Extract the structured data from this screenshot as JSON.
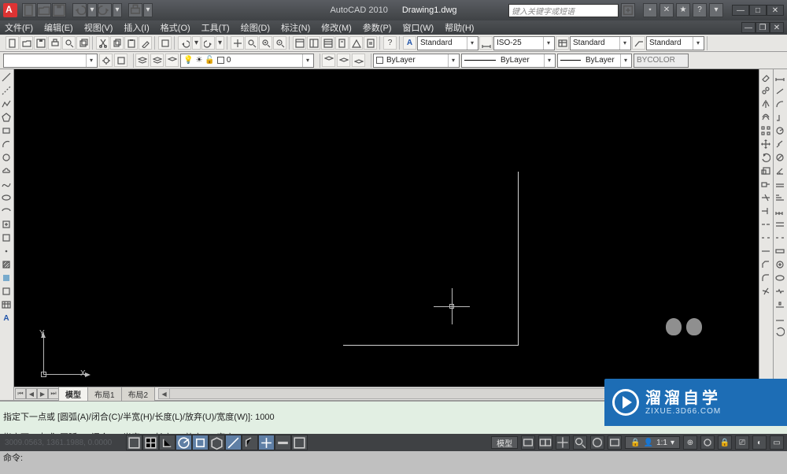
{
  "app": {
    "name": "AutoCAD 2010",
    "document": "Drawing1.dwg"
  },
  "search": {
    "placeholder": "键入关键字或短语"
  },
  "menu": [
    "文件(F)",
    "编辑(E)",
    "视图(V)",
    "插入(I)",
    "格式(O)",
    "工具(T)",
    "绘图(D)",
    "标注(N)",
    "修改(M)",
    "参数(P)",
    "窗口(W)",
    "帮助(H)"
  ],
  "styles": {
    "text": "Standard",
    "dim": "ISO-25",
    "table": "Standard",
    "mleader": "Standard"
  },
  "layers": {
    "current_layer": "0"
  },
  "properties": {
    "color": "ByLayer",
    "linetype": "ByLayer",
    "lineweight": "ByLayer",
    "plotstyle": "BYCOLOR"
  },
  "tabs": {
    "model": "模型",
    "layout1": "布局1",
    "layout2": "布局2"
  },
  "ucs": {
    "x": "X",
    "y": "Y"
  },
  "command": {
    "hist1": "指定下一点或 [圆弧(A)/闭合(C)/半宽(H)/长度(L)/放弃(U)/宽度(W)]: 1000",
    "hist2": "指定下一点或 [圆弧(A)/闭合(C)/半宽(H)/长度(L)/放弃(U)/宽度(W)]:",
    "prompt": "命令:",
    "input": ""
  },
  "status": {
    "coords": "3009.0563, 1361.1988, 0.0000",
    "space": "模型",
    "scale": "1:1"
  },
  "watermark": {
    "cn": "溜溜自学",
    "en": "ZIXUE.3D66.COM"
  }
}
